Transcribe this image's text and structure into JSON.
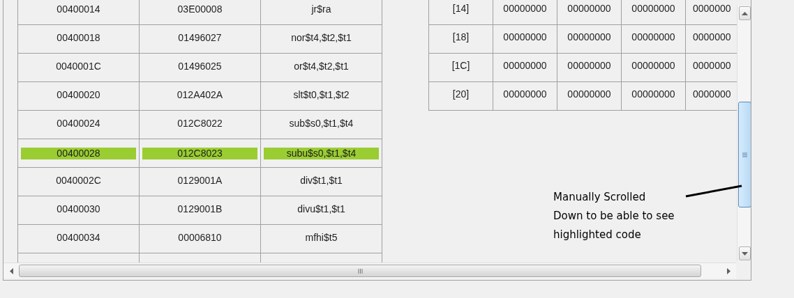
{
  "code_table": {
    "rows": [
      {
        "selected": false,
        "cells": [
          "00400014",
          "03E00008",
          "jr$ra"
        ]
      },
      {
        "selected": false,
        "cells": [
          "00400018",
          "01496027",
          "nor$t4,$t2,$t1"
        ]
      },
      {
        "selected": false,
        "cells": [
          "0040001C",
          "01496025",
          "or$t4,$t2,$t1"
        ]
      },
      {
        "selected": false,
        "cells": [
          "00400020",
          "012A402A",
          "slt$t0,$t1,$t2"
        ]
      },
      {
        "selected": false,
        "cells": [
          "00400024",
          "012C8022",
          "sub$s0,$t1,$t4"
        ]
      },
      {
        "selected": true,
        "cells": [
          "00400028",
          "012C8023",
          "subu$s0,$t1,$t4"
        ]
      },
      {
        "selected": false,
        "cells": [
          "0040002C",
          "0129001A",
          "div$t1,$t1"
        ]
      },
      {
        "selected": false,
        "cells": [
          "00400030",
          "0129001B",
          "divu$t1,$t1"
        ]
      },
      {
        "selected": false,
        "cells": [
          "00400034",
          "00006810",
          "mfhi$t5"
        ]
      }
    ]
  },
  "memory_table": {
    "rows": [
      {
        "cells": [
          "[14]",
          "00000000",
          "00000000",
          "00000000",
          "0000000"
        ]
      },
      {
        "cells": [
          "[18]",
          "00000000",
          "00000000",
          "00000000",
          "0000000"
        ]
      },
      {
        "cells": [
          "[1C]",
          "00000000",
          "00000000",
          "00000000",
          "0000000"
        ]
      },
      {
        "cells": [
          "[20]",
          "00000000",
          "00000000",
          "00000000",
          "0000000"
        ]
      }
    ]
  },
  "annotation": {
    "lines": [
      "Manually Scrolled",
      "Down to be able to see",
      "highlighted code"
    ]
  }
}
